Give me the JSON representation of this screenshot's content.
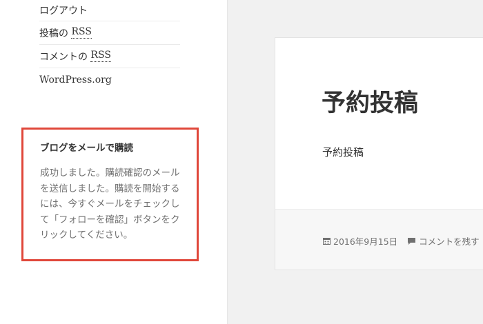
{
  "sidebar": {
    "meta_links": [
      {
        "label": "ログアウト"
      },
      {
        "prefix": "投稿の ",
        "abbr": "RSS"
      },
      {
        "prefix": "コメントの ",
        "abbr": "RSS"
      },
      {
        "label": "WordPress.org"
      }
    ],
    "subscribe_widget": {
      "title": "ブログをメールで購読",
      "message": "成功しました。購読確認のメールを送信しました。購読を開始するには、今すぐメールをチェックして「フォローを確認」ボタンをクリックしてください。"
    }
  },
  "post": {
    "title": "予約投稿",
    "content": "予約投稿",
    "date": "2016年9月15日",
    "comment_link": "コメントを残す"
  },
  "colors": {
    "highlight_border": "#e0473a",
    "background": "#f1f1f1"
  }
}
